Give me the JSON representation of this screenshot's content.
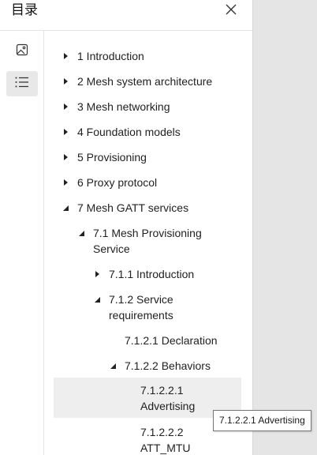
{
  "header": {
    "title": "目录"
  },
  "rail": {
    "items": [
      {
        "name": "image-icon",
        "active": false
      },
      {
        "name": "list-icon",
        "active": true
      }
    ]
  },
  "toc": {
    "items": [
      {
        "label": "1 Introduction",
        "arrow": "right"
      },
      {
        "label": "2 Mesh system architecture",
        "arrow": "right"
      },
      {
        "label": "3 Mesh networking",
        "arrow": "right"
      },
      {
        "label": "4 Foundation models",
        "arrow": "right"
      },
      {
        "label": "5 Provisioning",
        "arrow": "right"
      },
      {
        "label": "6 Proxy protocol",
        "arrow": "right"
      },
      {
        "label": "7 Mesh GATT services",
        "arrow": "down"
      },
      {
        "label": "7.1 Mesh Provisioning Service",
        "arrow": "down"
      },
      {
        "label": "7.1.1 Introduction",
        "arrow": "right"
      },
      {
        "label": "7.1.2 Service requirements",
        "arrow": "down"
      },
      {
        "label": "7.1.2.1 Declaration",
        "arrow": "none"
      },
      {
        "label": "7.1.2.2 Behaviors",
        "arrow": "down"
      },
      {
        "label": "7.1.2.2.1 Advertising",
        "arrow": "none"
      },
      {
        "label": "7.1.2.2.2 ATT_MTU",
        "arrow": "none"
      }
    ]
  },
  "tooltip": {
    "text": "7.1.2.2.1 Advertising"
  }
}
